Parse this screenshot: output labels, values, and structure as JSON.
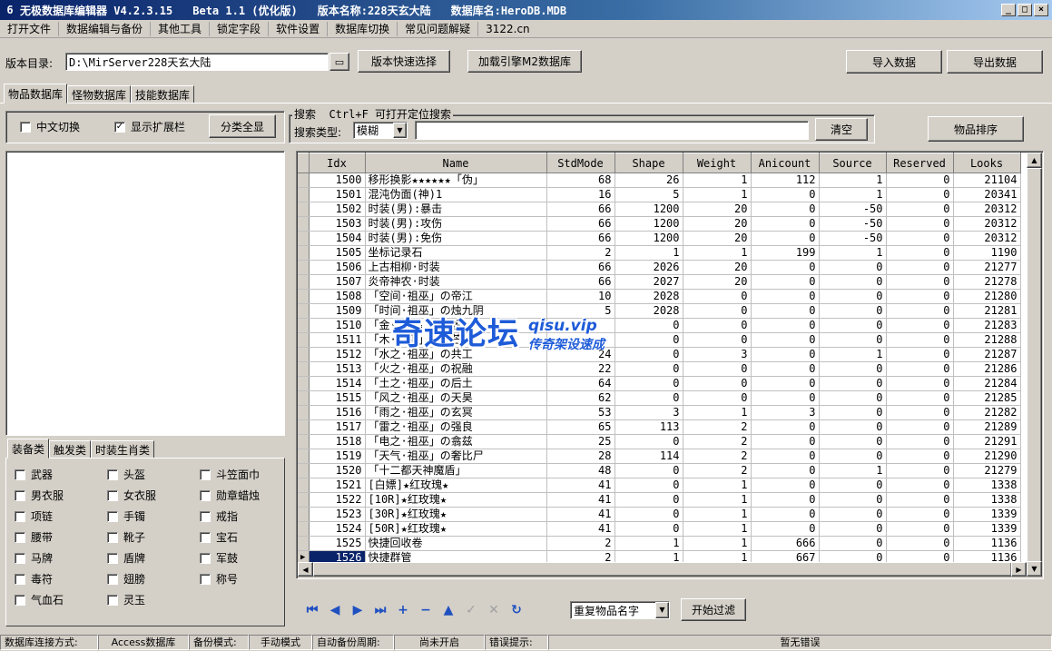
{
  "titlebar": {
    "app": "无极数据库编辑器 V4.2.3.15",
    "beta": "Beta 1.1 (优化版)",
    "version_name": "版本名称:228天玄大陆",
    "db_name": "数据库名:HeroDB.MDB",
    "minimize": "_",
    "maximize": "□",
    "close": "×"
  },
  "menu": [
    "打开文件",
    "数据编辑与备份",
    "其他工具",
    "锁定字段",
    "软件设置",
    "数据库切换",
    "常见问题解疑",
    "3122.cn"
  ],
  "toolbar": {
    "dir_label": "版本目录:",
    "dir_value": "D:\\MirServer228天玄大陆",
    "quick_select": "版本快速选择",
    "load_m2": "加载引擎M2数据库",
    "import": "导入数据",
    "export": "导出数据"
  },
  "tabs": [
    "物品数据库",
    "怪物数据库",
    "技能数据库"
  ],
  "options": {
    "cn_switch": "中文切换",
    "cn_checked": false,
    "show_ext": "显示扩展栏",
    "show_ext_checked": true,
    "show_all": "分类全显"
  },
  "search": {
    "title": "搜索  Ctrl+F 可打开定位搜索",
    "type_label": "搜索类型:",
    "type_value": "模糊",
    "query": "",
    "clear": "清空"
  },
  "sort_button": "物品排序",
  "category_tabs": [
    "装备类",
    "触发类",
    "时装生肖类"
  ],
  "categories": [
    [
      "武器",
      "头盔",
      "斗笠面巾"
    ],
    [
      "男衣服",
      "女衣服",
      "勋章蜡烛"
    ],
    [
      "项链",
      "手镯",
      "戒指"
    ],
    [
      "腰带",
      "靴子",
      "宝石"
    ],
    [
      "马牌",
      "盾牌",
      "军鼓"
    ],
    [
      "毒符",
      "翅膀",
      "称号"
    ],
    [
      "气血石",
      "灵玉",
      ""
    ]
  ],
  "table": {
    "columns": [
      "Idx",
      "Name",
      "StdMode",
      "Shape",
      "Weight",
      "Anicount",
      "Source",
      "Reserved",
      "Looks"
    ],
    "rows": [
      [
        "1500",
        "移形换影★★★★★★「伪」",
        "68",
        "26",
        "1",
        "112",
        "1",
        "0",
        "21104"
      ],
      [
        "1501",
        "混沌伪面(神)1",
        "16",
        "5",
        "1",
        "0",
        "1",
        "0",
        "20341"
      ],
      [
        "1502",
        "时装(男):暴击",
        "66",
        "1200",
        "20",
        "0",
        "-50",
        "0",
        "20312"
      ],
      [
        "1503",
        "时装(男):攻伤",
        "66",
        "1200",
        "20",
        "0",
        "-50",
        "0",
        "20312"
      ],
      [
        "1504",
        "时装(男):免伤",
        "66",
        "1200",
        "20",
        "0",
        "-50",
        "0",
        "20312"
      ],
      [
        "1505",
        "坐标记录石",
        "2",
        "1",
        "1",
        "199",
        "1",
        "0",
        "1190"
      ],
      [
        "1506",
        "上古相柳·时装",
        "66",
        "2026",
        "20",
        "0",
        "0",
        "0",
        "21277"
      ],
      [
        "1507",
        "炎帝神农·时装",
        "66",
        "2027",
        "20",
        "0",
        "0",
        "0",
        "21278"
      ],
      [
        "1508",
        "「空间·祖巫」の帝江",
        "10",
        "2028",
        "0",
        "0",
        "0",
        "0",
        "21280"
      ],
      [
        "1509",
        "「时间·祖巫」の烛九阴",
        "5",
        "2028",
        "0",
        "0",
        "0",
        "0",
        "21281"
      ],
      [
        "1510",
        "「金·祖巫」の蓐收",
        "",
        "0",
        "0",
        "0",
        "0",
        "0",
        "21283"
      ],
      [
        "1511",
        "「木·祖巫」の句芒",
        "",
        "0",
        "0",
        "0",
        "0",
        "0",
        "21288"
      ],
      [
        "1512",
        "「水之·祖巫」の共工",
        "24",
        "0",
        "3",
        "0",
        "1",
        "0",
        "21287"
      ],
      [
        "1513",
        "「火之·祖巫」の祝融",
        "22",
        "0",
        "0",
        "0",
        "0",
        "0",
        "21286"
      ],
      [
        "1514",
        "「土之·祖巫」の后土",
        "64",
        "0",
        "0",
        "0",
        "0",
        "0",
        "21284"
      ],
      [
        "1515",
        "「风之·祖巫」の天昊",
        "62",
        "0",
        "0",
        "0",
        "0",
        "0",
        "21285"
      ],
      [
        "1516",
        "「雨之·祖巫」の玄冥",
        "53",
        "3",
        "1",
        "3",
        "0",
        "0",
        "21282"
      ],
      [
        "1517",
        "「雷之·祖巫」の强良",
        "65",
        "113",
        "2",
        "0",
        "0",
        "0",
        "21289"
      ],
      [
        "1518",
        "「电之·祖巫」の翕兹",
        "25",
        "0",
        "2",
        "0",
        "0",
        "0",
        "21291"
      ],
      [
        "1519",
        "「天气·祖巫」の奢比尸",
        "28",
        "114",
        "2",
        "0",
        "0",
        "0",
        "21290"
      ],
      [
        "1520",
        "「十二都天神魔盾」",
        "48",
        "0",
        "2",
        "0",
        "1",
        "0",
        "21279"
      ],
      [
        "1521",
        "[白嫖]★红玫瑰★",
        "41",
        "0",
        "1",
        "0",
        "0",
        "0",
        "1338"
      ],
      [
        "1522",
        "[10R]★红玫瑰★",
        "41",
        "0",
        "1",
        "0",
        "0",
        "0",
        "1338"
      ],
      [
        "1523",
        "[30R]★红玫瑰★",
        "41",
        "0",
        "1",
        "0",
        "0",
        "0",
        "1339"
      ],
      [
        "1524",
        "[50R]★红玫瑰★",
        "41",
        "0",
        "1",
        "0",
        "0",
        "0",
        "1339"
      ],
      [
        "1525",
        "快捷回收卷",
        "2",
        "1",
        "1",
        "666",
        "0",
        "0",
        "1136"
      ],
      [
        "1526",
        "快捷群管",
        "2",
        "1",
        "1",
        "667",
        "0",
        "0",
        "1136"
      ]
    ],
    "selected_index": 26
  },
  "bottom": {
    "filter_value": "重复物品名字",
    "start_filter": "开始过滤"
  },
  "status": {
    "conn_label": "数据库连接方式:",
    "conn_value": "Access数据库",
    "backup_label": "备份模式:",
    "backup_value": "手动模式",
    "auto_label": "自动备份周期:",
    "auto_value": "尚未开启",
    "error_label": "错误提示:",
    "error_value": "暂无错误"
  },
  "watermark": {
    "main": "奇速论坛",
    "site": "qisu.vip",
    "sub": "传奇架设速成"
  }
}
